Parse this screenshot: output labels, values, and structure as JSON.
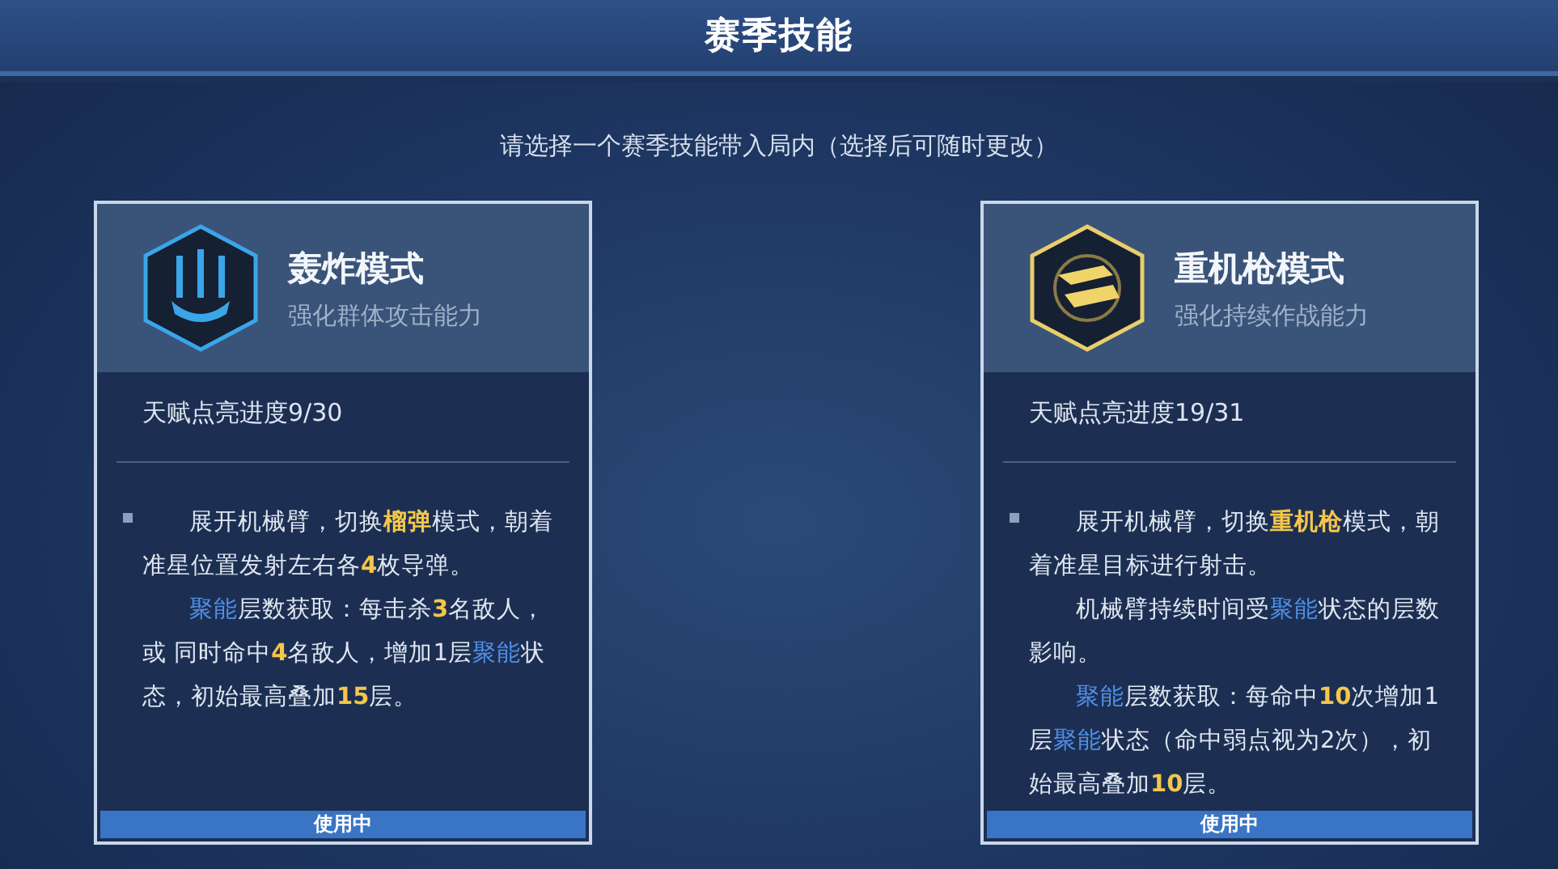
{
  "title": "赛季技能",
  "subtitle": "请选择一个赛季技能带入局内（选择后可随时更改）",
  "cards": [
    {
      "kind": "missiles",
      "name": "轰炸模式",
      "tagline": "强化群体攻击能力",
      "progress": "天赋点亮进度9/30",
      "status": "使用中",
      "paragraphs": [
        [
          {
            "kind": "text",
            "text": "展开机械臂，切换"
          },
          {
            "kind": "gold",
            "text": "榴弹"
          },
          {
            "kind": "text",
            "text": "模式，朝着准星位置发射左右各"
          },
          {
            "kind": "gold",
            "text": "4"
          },
          {
            "kind": "text",
            "text": "枚导弹。"
          }
        ],
        [
          {
            "kind": "blue",
            "text": "聚能"
          },
          {
            "kind": "text",
            "text": "层数获取：每击杀"
          },
          {
            "kind": "gold",
            "text": "3"
          },
          {
            "kind": "text",
            "text": "名敌人，或 同时命中"
          },
          {
            "kind": "gold",
            "text": "4"
          },
          {
            "kind": "text",
            "text": "名敌人，增加1层"
          },
          {
            "kind": "blue",
            "text": "聚能"
          },
          {
            "kind": "text",
            "text": "状态，初始最高叠加"
          },
          {
            "kind": "gold",
            "text": "15"
          },
          {
            "kind": "text",
            "text": "层。"
          }
        ]
      ]
    },
    {
      "kind": "gun",
      "name": "重机枪模式",
      "tagline": "强化持续作战能力",
      "progress": "天赋点亮进度19/31",
      "status": "使用中",
      "paragraphs": [
        [
          {
            "kind": "text",
            "text": "展开机械臂，切换"
          },
          {
            "kind": "gold",
            "text": "重机枪"
          },
          {
            "kind": "text",
            "text": "模式，朝着准星目标进行射击。"
          }
        ],
        [
          {
            "kind": "text",
            "text": "机械臂持续时间受"
          },
          {
            "kind": "blue",
            "text": "聚能"
          },
          {
            "kind": "text",
            "text": "状态的层数影响。"
          }
        ],
        [
          {
            "kind": "blue",
            "text": "聚能"
          },
          {
            "kind": "text",
            "text": "层数获取：每命中"
          },
          {
            "kind": "gold",
            "text": "10"
          },
          {
            "kind": "text",
            "text": "次增加1层"
          },
          {
            "kind": "blue",
            "text": "聚能"
          },
          {
            "kind": "text",
            "text": "状态（命中弱点视为2次），初始最高叠加"
          },
          {
            "kind": "gold",
            "text": "10"
          },
          {
            "kind": "text",
            "text": "层。"
          }
        ]
      ]
    }
  ]
}
